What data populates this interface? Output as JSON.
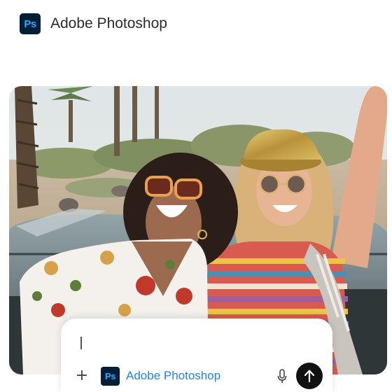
{
  "header": {
    "logo_text": "Ps",
    "title": "Adobe Photoshop"
  },
  "photo": {
    "subject": "photo-image"
  },
  "prompt": {
    "input_value": "",
    "plus_icon": "plus-icon",
    "app_chip": {
      "logo_text": "Ps",
      "label": "Adobe Photoshop"
    },
    "mic_icon": "microphone-icon",
    "send_icon": "arrow-up-icon"
  },
  "colors": {
    "ps_dark": "#001e36",
    "ps_blue": "#31a8ff",
    "link_blue": "#2680eb",
    "send_bg": "#111111"
  }
}
